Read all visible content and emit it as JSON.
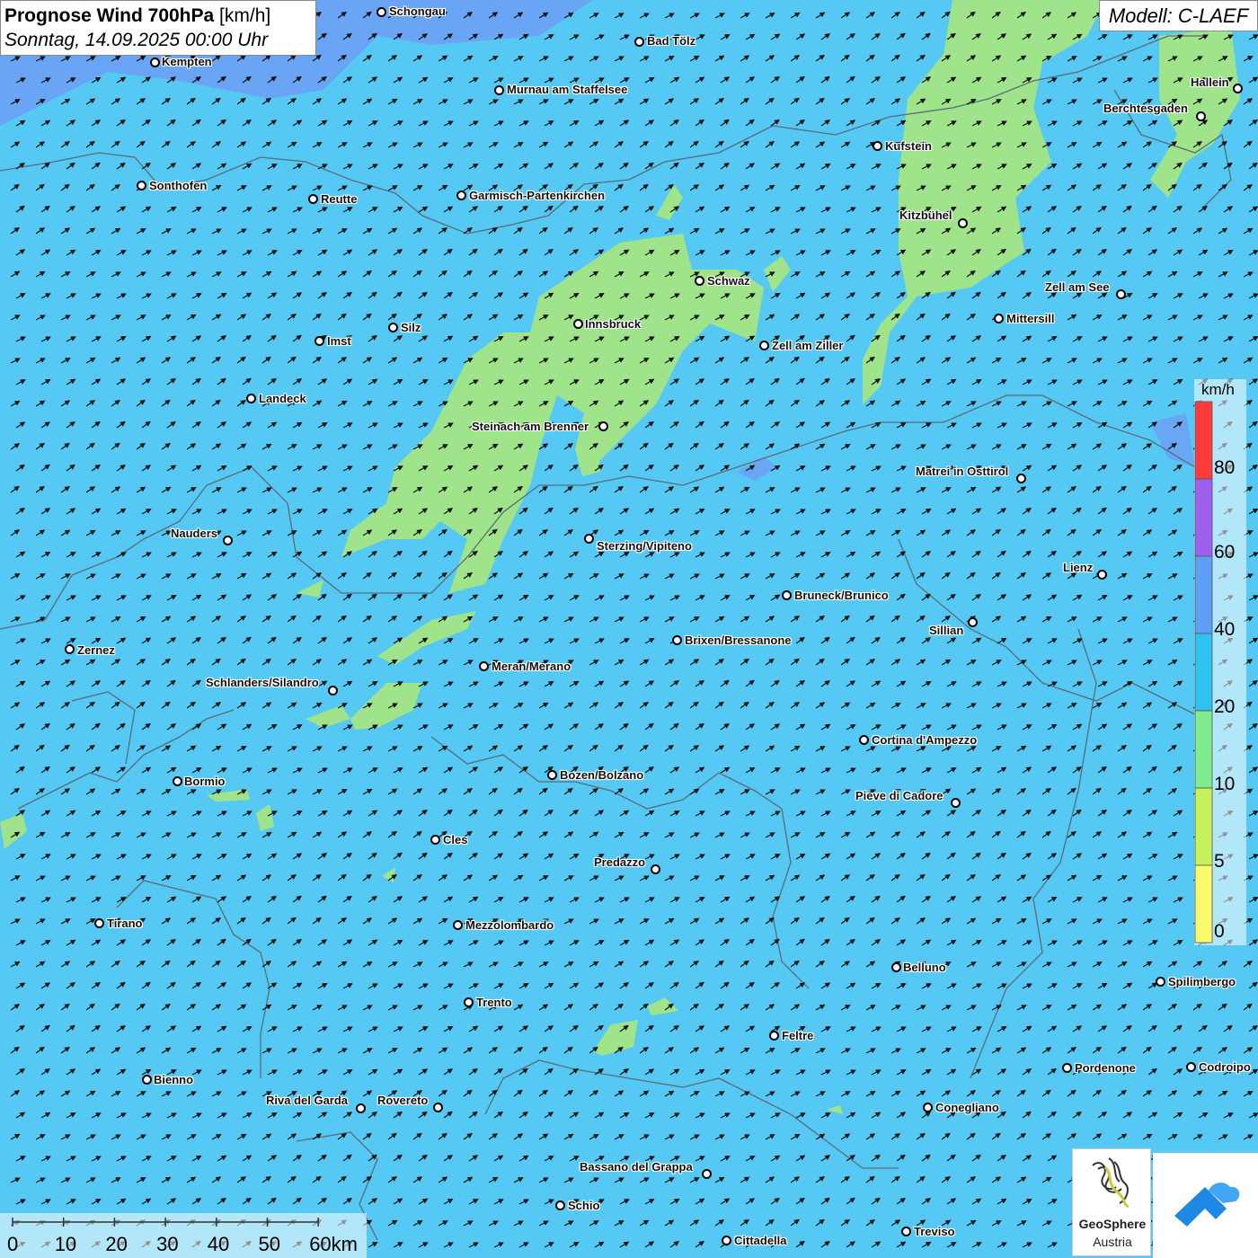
{
  "title": {
    "main": "Prognose Wind 700hPa",
    "unit": "[km/h]",
    "datetime": "Sonntag, 14.09.2025 00:00 Uhr"
  },
  "model": "Modell: C-LAEF",
  "legend": {
    "unit": "km/h",
    "ticks": [
      "80",
      "60",
      "40",
      "20",
      "10",
      "5",
      "0"
    ],
    "colors": [
      "#ff3b3b",
      "#9d61ee",
      "#5f9ef5",
      "#2ec3ee",
      "#7fea8e",
      "#c6f05c",
      "#fafa6e"
    ]
  },
  "scale_bar": {
    "ticks": [
      "0",
      "10",
      "20",
      "30",
      "40",
      "50",
      "60km"
    ]
  },
  "colors": {
    "wind_20_40": "#55c9f3",
    "wind_10_20": "#9fe48b",
    "wind_40_60": "#6e9ff4"
  },
  "cities": [
    {
      "name": "Schongau"
    },
    {
      "name": "Bad Tölz"
    },
    {
      "name": "Kempten"
    },
    {
      "name": "Murnau am Staffelsee"
    },
    {
      "name": "Hallein"
    },
    {
      "name": "Berchtesgaden"
    },
    {
      "name": "Kufstein"
    },
    {
      "name": "Sonthofen"
    },
    {
      "name": "Reutte"
    },
    {
      "name": "Garmisch-Partenkirchen"
    },
    {
      "name": "Kitzbühel"
    },
    {
      "name": "Schwaz"
    },
    {
      "name": "Zell am See"
    },
    {
      "name": "Mittersill"
    },
    {
      "name": "Innsbruck"
    },
    {
      "name": "Silz"
    },
    {
      "name": "Imst"
    },
    {
      "name": "Zell am Ziller"
    },
    {
      "name": "Landeck"
    },
    {
      "name": "Steinach am Brenner"
    },
    {
      "name": "Matrei in Osttirol"
    },
    {
      "name": "Nauders"
    },
    {
      "name": "Sterzing/Vipiteno"
    },
    {
      "name": "Lienz"
    },
    {
      "name": "Bruneck/Brunico"
    },
    {
      "name": "Sillian"
    },
    {
      "name": "Brixen/Bressanone"
    },
    {
      "name": "Zernez"
    },
    {
      "name": "Meran/Merano"
    },
    {
      "name": "Schlanders/Silandro"
    },
    {
      "name": "Cortina d'Ampezzo"
    },
    {
      "name": "Bormio"
    },
    {
      "name": "Bozen/Bolzano"
    },
    {
      "name": "Pieve di Cadore"
    },
    {
      "name": "Cles"
    },
    {
      "name": "Predazzo"
    },
    {
      "name": "Tirano"
    },
    {
      "name": "Mezzolombardo"
    },
    {
      "name": "Belluno"
    },
    {
      "name": "Spilimbergo"
    },
    {
      "name": "Trento"
    },
    {
      "name": "Feltre"
    },
    {
      "name": "Pordenone"
    },
    {
      "name": "Codroipo"
    },
    {
      "name": "Bienno"
    },
    {
      "name": "Riva del Garda"
    },
    {
      "name": "Rovereto"
    },
    {
      "name": "Conegliano"
    },
    {
      "name": "Bassano del Grappa"
    },
    {
      "name": "Schio"
    },
    {
      "name": "Treviso"
    },
    {
      "name": "Cittadella"
    }
  ],
  "logo": {
    "line1": "GeoSphere",
    "line2": "Austria"
  }
}
